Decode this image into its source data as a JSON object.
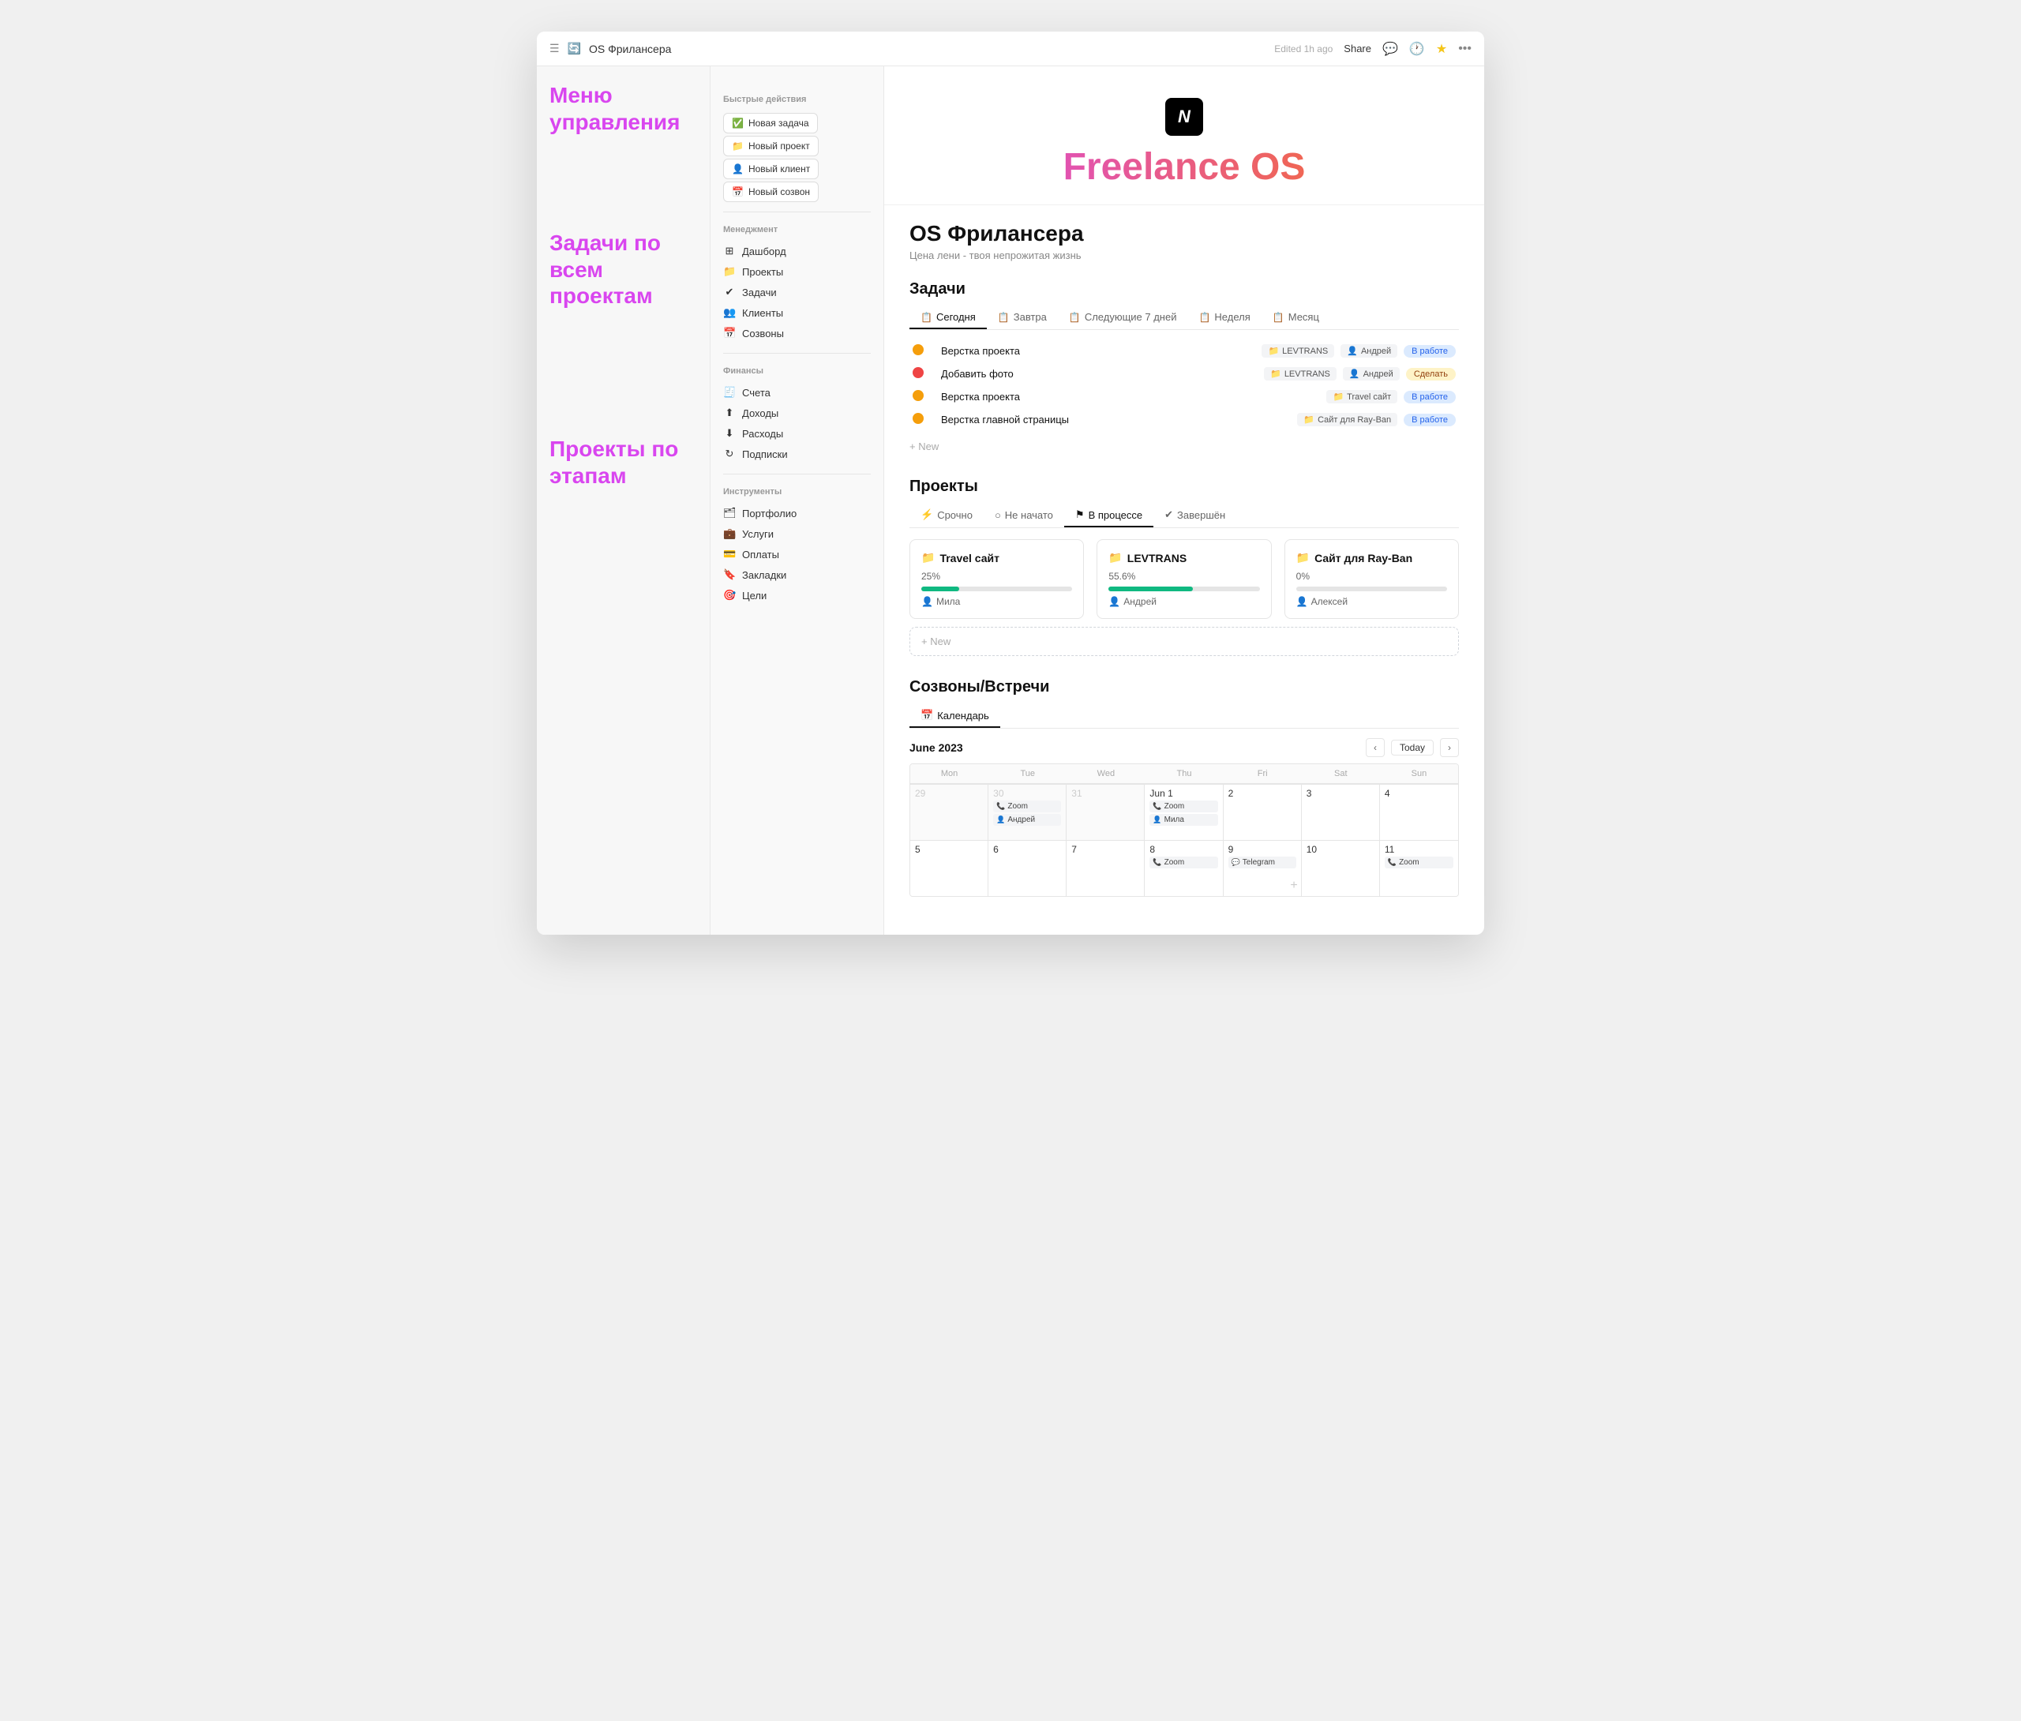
{
  "topbar": {
    "title": "OS Фрилансера",
    "edited": "Edited 1h ago",
    "share": "Share"
  },
  "hero": {
    "logo_text": "N",
    "title_pink": "Freelance",
    "title_orange": "OS"
  },
  "page": {
    "main_title": "OS Фрилансера",
    "subtitle": "Цена лени - твоя непрожитая жизнь"
  },
  "annotations": {
    "menu": "Меню управления",
    "tasks": "Задачи по всем проектам",
    "projects": "Проекты по этапам"
  },
  "quick_actions": {
    "title": "Быстрые действия",
    "buttons": [
      {
        "icon": "✔",
        "label": "Новая задача"
      },
      {
        "icon": "📁",
        "label": "Новый проект"
      },
      {
        "icon": "👤",
        "label": "Новый клиент"
      },
      {
        "icon": "📅",
        "label": "Новый созвон"
      }
    ]
  },
  "management": {
    "title": "Менеджмент",
    "items": [
      {
        "icon": "⊞",
        "label": "Дашборд"
      },
      {
        "icon": "📁",
        "label": "Проекты"
      },
      {
        "icon": "✔",
        "label": "Задачи"
      },
      {
        "icon": "👥",
        "label": "Клиенты"
      },
      {
        "icon": "📅",
        "label": "Созвоны"
      }
    ]
  },
  "finance": {
    "title": "Финансы",
    "items": [
      {
        "icon": "🧾",
        "label": "Счета"
      },
      {
        "icon": "↑",
        "label": "Доходы"
      },
      {
        "icon": "↓",
        "label": "Расходы"
      },
      {
        "icon": "↻",
        "label": "Подписки"
      }
    ]
  },
  "tools": {
    "title": "Инструменты",
    "items": [
      {
        "icon": "🗂",
        "label": "Портфолио"
      },
      {
        "icon": "💼",
        "label": "Услуги"
      },
      {
        "icon": "💳",
        "label": "Оплаты"
      },
      {
        "icon": "🔖",
        "label": "Закладки"
      },
      {
        "icon": "🎯",
        "label": "Цели"
      }
    ]
  },
  "tasks_section": {
    "heading": "Задачи",
    "tabs": [
      {
        "label": "Сегодня",
        "icon": "📋",
        "active": true
      },
      {
        "label": "Завтра",
        "icon": "📋",
        "active": false
      },
      {
        "label": "Следующие 7 дней",
        "icon": "📋",
        "active": false
      },
      {
        "label": "Неделя",
        "icon": "📋",
        "active": false
      },
      {
        "label": "Месяц",
        "icon": "📋",
        "active": false
      }
    ],
    "tasks": [
      {
        "name": "Верстка проекта",
        "dot": "yellow",
        "folder": "LEVTRANS",
        "person": "Андрей",
        "badge": "В работе",
        "badge_type": "inwork"
      },
      {
        "name": "Добавить фото",
        "dot": "red",
        "folder": "LEVTRANS",
        "person": "Андрей",
        "badge": "Сделать",
        "badge_type": "todo"
      },
      {
        "name": "Верстка проекта",
        "dot": "yellow",
        "folder": "Travel сайт",
        "person": "",
        "badge": "В работе",
        "badge_type": "inwork"
      },
      {
        "name": "Верстка главной страницы",
        "dot": "yellow",
        "folder": "Сайт для Ray-Ban",
        "person": "",
        "badge": "В работе",
        "badge_type": "inwork"
      }
    ],
    "add_label": "+ New"
  },
  "projects_section": {
    "heading": "Проекты",
    "tabs": [
      {
        "label": "Срочно",
        "icon": "⚡",
        "active": false
      },
      {
        "label": "Не начато",
        "icon": "○",
        "active": false
      },
      {
        "label": "В процессе",
        "icon": "⚑",
        "active": true
      },
      {
        "label": "Завершён",
        "icon": "✔",
        "active": false
      }
    ],
    "projects": [
      {
        "name": "Travel сайт",
        "icon": "📁",
        "percent": "25%",
        "progress": 25,
        "person": "Мила"
      },
      {
        "name": "LEVTRANS",
        "icon": "📁",
        "percent": "55.6%",
        "progress": 56,
        "person": "Андрей"
      },
      {
        "name": "Сайт для Ray-Ban",
        "icon": "📁",
        "percent": "0%",
        "progress": 0,
        "person": "Алексей"
      }
    ],
    "add_label": "+ New"
  },
  "calls_section": {
    "heading": "Созвоны/Встречи",
    "tab_label": "Календарь",
    "month": "June 2023",
    "today_label": "Today",
    "days": [
      "Mon",
      "Tue",
      "Wed",
      "Thu",
      "Fri",
      "Sat",
      "Sun"
    ],
    "weeks": [
      [
        {
          "date": "29",
          "other": true,
          "events": []
        },
        {
          "date": "30",
          "other": true,
          "events": [
            {
              "icon": "📞",
              "label": "Zoom"
            },
            {
              "icon": "👤",
              "label": "Андрей"
            }
          ]
        },
        {
          "date": "31",
          "other": true,
          "events": []
        },
        {
          "date": "Jun 1",
          "other": false,
          "events": [
            {
              "icon": "📞",
              "label": "Zoom"
            },
            {
              "icon": "👤",
              "label": "Мила"
            }
          ]
        },
        {
          "date": "2",
          "other": false,
          "events": []
        },
        {
          "date": "3",
          "other": false,
          "events": []
        },
        {
          "date": "4",
          "other": false,
          "events": []
        }
      ],
      [
        {
          "date": "5",
          "other": false,
          "events": []
        },
        {
          "date": "6",
          "other": false,
          "events": []
        },
        {
          "date": "7",
          "other": false,
          "events": []
        },
        {
          "date": "8",
          "other": false,
          "events": [
            {
              "icon": "📞",
              "label": "Zoom"
            }
          ]
        },
        {
          "date": "9",
          "other": false,
          "events": [
            {
              "icon": "💬",
              "label": "Telegram"
            }
          ],
          "add": true
        },
        {
          "date": "10",
          "other": false,
          "events": []
        },
        {
          "date": "11",
          "other": false,
          "events": [
            {
              "icon": "📞",
              "label": "Zoom"
            }
          ]
        }
      ]
    ]
  }
}
